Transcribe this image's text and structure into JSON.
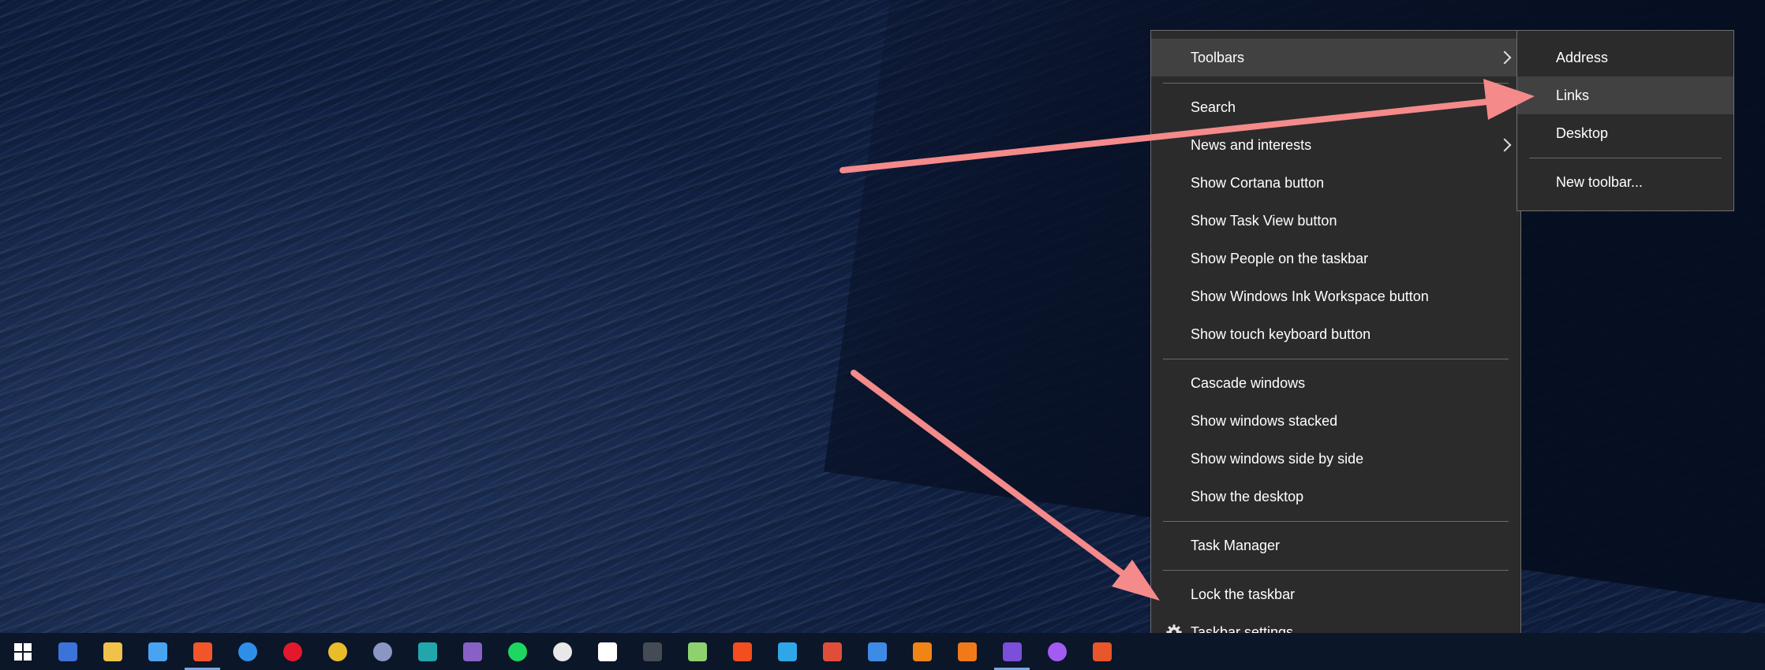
{
  "context_menu": {
    "items": [
      {
        "label": "Toolbars"
      },
      {
        "label": "Search"
      },
      {
        "label": "News and interests"
      },
      {
        "label": "Show Cortana button"
      },
      {
        "label": "Show Task View button"
      },
      {
        "label": "Show People on the taskbar"
      },
      {
        "label": "Show Windows Ink Workspace button"
      },
      {
        "label": "Show touch keyboard button"
      },
      {
        "label": "Cascade windows"
      },
      {
        "label": "Show windows stacked"
      },
      {
        "label": "Show windows side by side"
      },
      {
        "label": "Show the desktop"
      },
      {
        "label": "Task Manager"
      },
      {
        "label": "Lock the taskbar"
      },
      {
        "label": "Taskbar settings"
      }
    ]
  },
  "toolbars_submenu": {
    "items": [
      {
        "label": "Address"
      },
      {
        "label": "Links"
      },
      {
        "label": "Desktop"
      },
      {
        "label": "New toolbar..."
      }
    ]
  },
  "taskbar": {
    "icons": [
      {
        "name": "windows-start-icon",
        "color": "#ffffff"
      },
      {
        "name": "save-disk-icon",
        "color": "#3b73d9"
      },
      {
        "name": "file-explorer-icon",
        "color": "#f0c24a"
      },
      {
        "name": "mail-icon",
        "color": "#4aa3f0"
      },
      {
        "name": "brave-icon",
        "color": "#f1562b"
      },
      {
        "name": "firefox-icon",
        "color": "#2f8fe8"
      },
      {
        "name": "opera-icon",
        "color": "#e3182d"
      },
      {
        "name": "chrome-icon",
        "color": "#e9bc2a"
      },
      {
        "name": "keepass-icon",
        "color": "#8a97c4"
      },
      {
        "name": "vscode-icon",
        "color": "#23a6ab"
      },
      {
        "name": "visual-studio-icon",
        "color": "#8861c7"
      },
      {
        "name": "spotify-icon",
        "color": "#1ed760"
      },
      {
        "name": "slack-icon",
        "color": "#e8e8e8"
      },
      {
        "name": "notion-icon",
        "color": "#ffffff"
      },
      {
        "name": "terminal-icon",
        "color": "#444b55"
      },
      {
        "name": "notepad-plus-icon",
        "color": "#8ed16f"
      },
      {
        "name": "figma-icon",
        "color": "#f24e1e"
      },
      {
        "name": "affinity-designer-icon",
        "color": "#2fa6e8"
      },
      {
        "name": "xmind-icon",
        "color": "#e04e3a"
      },
      {
        "name": "todo-icon",
        "color": "#3e8be6"
      },
      {
        "name": "vlc-icon",
        "color": "#f08516"
      },
      {
        "name": "sketchbook-icon",
        "color": "#f07a1a"
      },
      {
        "name": "obsidian-icon",
        "color": "#7b4fd9"
      },
      {
        "name": "messenger-icon",
        "color": "#a35bf2"
      },
      {
        "name": "calendar-icon",
        "color": "#e8562a"
      }
    ]
  },
  "colors": {
    "annotation_arrow": "#f48a8a",
    "menu_bg": "#2b2b2b",
    "menu_hover": "#414141",
    "taskbar_bg": "#0c1629"
  }
}
